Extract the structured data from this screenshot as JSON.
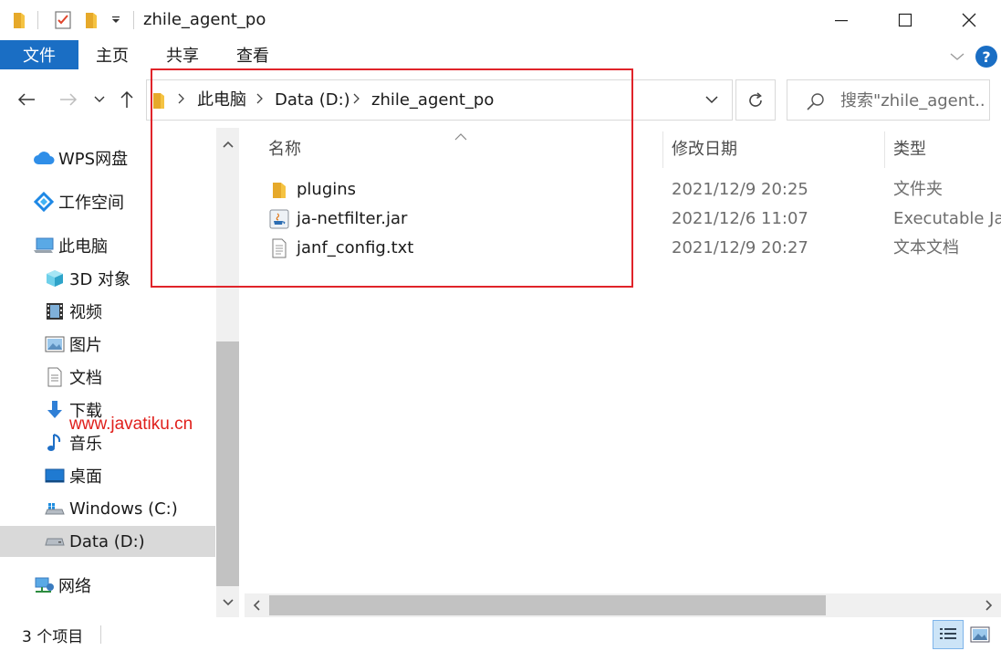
{
  "window": {
    "title": "zhile_agent_po",
    "minimize_icon": "minimize-icon",
    "maximize_icon": "maximize-icon",
    "close_icon": "close-icon"
  },
  "ribbon": {
    "tabs": [
      {
        "label": "文件"
      },
      {
        "label": "主页"
      },
      {
        "label": "共享"
      },
      {
        "label": "查看"
      }
    ],
    "accent_color": "#1a6ec4"
  },
  "address": {
    "breadcrumbs": [
      {
        "label": "此电脑"
      },
      {
        "label": "Data (D:)"
      },
      {
        "label": "zhile_agent_po"
      }
    ],
    "search_placeholder": "搜索\"zhile_agent..."
  },
  "navigation": {
    "items": [
      {
        "label": "WPS网盘",
        "icon": "cloud-icon"
      },
      {
        "label": "工作空间",
        "icon": "workspace-icon"
      },
      {
        "label": "此电脑",
        "icon": "computer-icon"
      },
      {
        "label": "3D 对象",
        "icon": "3d-objects-icon"
      },
      {
        "label": "视频",
        "icon": "video-icon"
      },
      {
        "label": "图片",
        "icon": "pictures-icon"
      },
      {
        "label": "文档",
        "icon": "documents-icon"
      },
      {
        "label": "下载",
        "icon": "download-icon"
      },
      {
        "label": "音乐",
        "icon": "music-icon"
      },
      {
        "label": "桌面",
        "icon": "desktop-icon"
      },
      {
        "label": "Windows (C:)",
        "icon": "drive-icon"
      },
      {
        "label": "Data (D:)",
        "icon": "drive-icon",
        "selected": true
      },
      {
        "label": "网络",
        "icon": "network-icon"
      }
    ],
    "watermark": "www.javatiku.cn"
  },
  "file_list": {
    "columns": [
      {
        "label": "名称"
      },
      {
        "label": "修改日期"
      },
      {
        "label": "类型"
      }
    ],
    "rows": [
      {
        "name": "plugins",
        "date": "2021/12/9 20:25",
        "type": "文件夹",
        "icon": "folder-icon"
      },
      {
        "name": "ja-netfilter.jar",
        "date": "2021/12/6 11:07",
        "type": "Executable Jar File",
        "icon": "java-jar-icon"
      },
      {
        "name": "janf_config.txt",
        "date": "2021/12/9 20:27",
        "type": "文本文档",
        "icon": "text-file-icon"
      }
    ]
  },
  "status": {
    "item_count": "3 个项目"
  },
  "highlight_color": "#e0242a"
}
